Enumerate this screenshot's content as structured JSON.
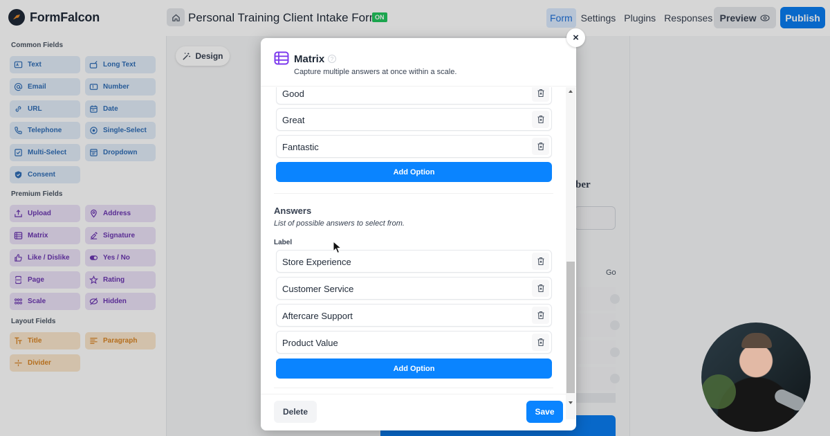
{
  "app": {
    "name": "FormFalcon",
    "form_title": "Personal Training Client Intake Form",
    "status_badge": "ON"
  },
  "nav": {
    "items": [
      {
        "label": "Form",
        "active": true
      },
      {
        "label": "Settings",
        "active": false
      },
      {
        "label": "Plugins",
        "active": false
      },
      {
        "label": "Responses",
        "active": false
      }
    ],
    "preview_label": "Preview",
    "publish_label": "Publish"
  },
  "sidebar": {
    "common_label": "Common Fields",
    "common": [
      {
        "label": "Text",
        "icon": "text-field-icon"
      },
      {
        "label": "Long Text",
        "icon": "long-text-icon"
      },
      {
        "label": "Email",
        "icon": "at-sign-icon"
      },
      {
        "label": "Number",
        "icon": "number-icon"
      },
      {
        "label": "URL",
        "icon": "link-icon"
      },
      {
        "label": "Date",
        "icon": "calendar-icon"
      },
      {
        "label": "Telephone",
        "icon": "phone-icon"
      },
      {
        "label": "Single-Select",
        "icon": "radio-icon"
      },
      {
        "label": "Multi-Select",
        "icon": "checkbox-icon"
      },
      {
        "label": "Dropdown",
        "icon": "dropdown-icon"
      },
      {
        "label": "Consent",
        "icon": "shield-check-icon"
      }
    ],
    "premium_label": "Premium Fields",
    "premium": [
      {
        "label": "Upload",
        "icon": "upload-icon"
      },
      {
        "label": "Address",
        "icon": "map-pin-icon"
      },
      {
        "label": "Matrix",
        "icon": "table-icon"
      },
      {
        "label": "Signature",
        "icon": "signature-icon"
      },
      {
        "label": "Like / Dislike",
        "icon": "thumbs-up-icon"
      },
      {
        "label": "Yes / No",
        "icon": "toggle-icon"
      },
      {
        "label": "Page",
        "icon": "page-break-icon"
      },
      {
        "label": "Rating",
        "icon": "star-icon"
      },
      {
        "label": "Scale",
        "icon": "dots-grid-icon"
      },
      {
        "label": "Hidden",
        "icon": "eye-off-icon"
      }
    ],
    "layout_label": "Layout Fields",
    "layout": [
      {
        "label": "Title",
        "icon": "heading-icon"
      },
      {
        "label": "Paragraph",
        "icon": "paragraph-icon"
      },
      {
        "label": "Divider",
        "icon": "divider-icon"
      }
    ]
  },
  "canvas": {
    "design_label": "Design",
    "partial_heading": "ber",
    "partial_col": "Go"
  },
  "modal": {
    "title": "Matrix",
    "help": "?",
    "subtitle": "Capture multiple answers at once within a scale.",
    "scale_options": [
      "Good",
      "Great",
      "Fantastic"
    ],
    "add_option_label": "Add Option",
    "answers_title": "Answers",
    "answers_subtitle": "List of possible answers to select from.",
    "label_heading": "Label",
    "answers": [
      "Store Experience",
      "Customer Service",
      "Aftercare Support",
      "Product Value"
    ],
    "delete_label": "Delete",
    "save_label": "Save",
    "close_symbol": "×"
  },
  "colors": {
    "primary": "#0a84ff",
    "publish": "#0a7cf0",
    "badge_on": "#22c55e",
    "common_field": "#2f6db5",
    "premium_field": "#6a35b0",
    "layout_field": "#d78424"
  }
}
